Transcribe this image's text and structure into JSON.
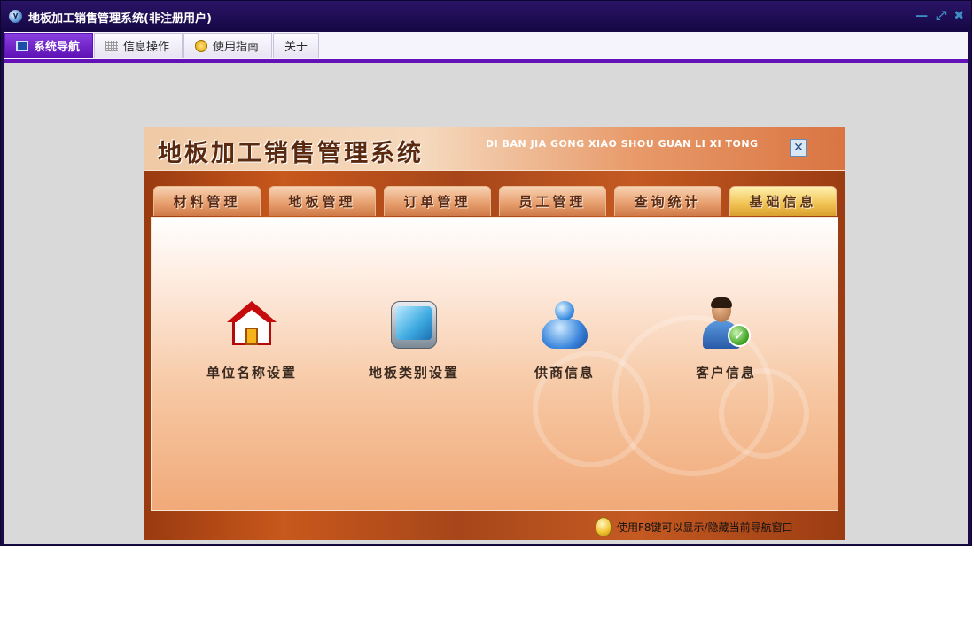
{
  "window": {
    "title": "地板加工销售管理系统(非注册用户)",
    "app_icon_letter": "y"
  },
  "menubar": {
    "items": [
      {
        "label": "系统导航",
        "active": true
      },
      {
        "label": "信息操作",
        "active": false
      },
      {
        "label": "使用指南",
        "active": false
      },
      {
        "label": "关于",
        "active": false
      }
    ]
  },
  "nav_panel": {
    "title": "地板加工销售管理系统",
    "pinyin": "DI BAN JIA GONG XIAO SHOU GUAN LI XI TONG",
    "tabs": [
      {
        "label": "材料管理"
      },
      {
        "label": "地板管理"
      },
      {
        "label": "订单管理"
      },
      {
        "label": "员工管理"
      },
      {
        "label": "查询统计"
      },
      {
        "label": "基础信息",
        "active": true
      }
    ],
    "items": [
      {
        "label": "单位名称设置",
        "icon": "house-icon"
      },
      {
        "label": "地板类别设置",
        "icon": "monitor-icon"
      },
      {
        "label": "供商信息",
        "icon": "messenger-user-icon"
      },
      {
        "label": "客户信息",
        "icon": "user-check-icon"
      }
    ],
    "hint": "使用F8键可以显示/隐藏当前导航窗口"
  },
  "colors": {
    "titlebar": "#1a0a4a",
    "menu_accent": "#6312b8",
    "workspace": "#d9d9d9",
    "panel_wood": "#b04a18"
  }
}
